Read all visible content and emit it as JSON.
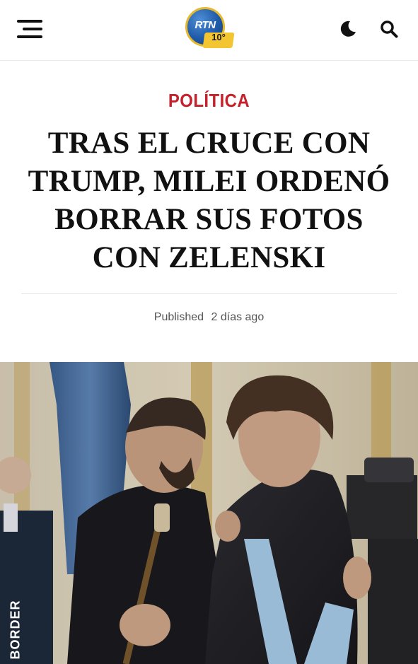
{
  "header": {
    "logo_text": "RTN",
    "logo_badge": "10°",
    "icons": {
      "menu": "hamburger-menu-icon",
      "theme": "moon-icon",
      "search": "search-icon"
    }
  },
  "article": {
    "category": "POLÍTICA",
    "title": "TRAS EL CRUCE CON TRUMP, MILEI ORDENÓ BORRAR SUS FOTOS CON ZELENSKI",
    "published_label": "Published",
    "published_date": "2 días ago",
    "photo_watermark": "BORDER"
  },
  "colors": {
    "category": "#c6202a",
    "logo_blue": "#1f5aa8",
    "logo_gold": "#f2c531"
  }
}
